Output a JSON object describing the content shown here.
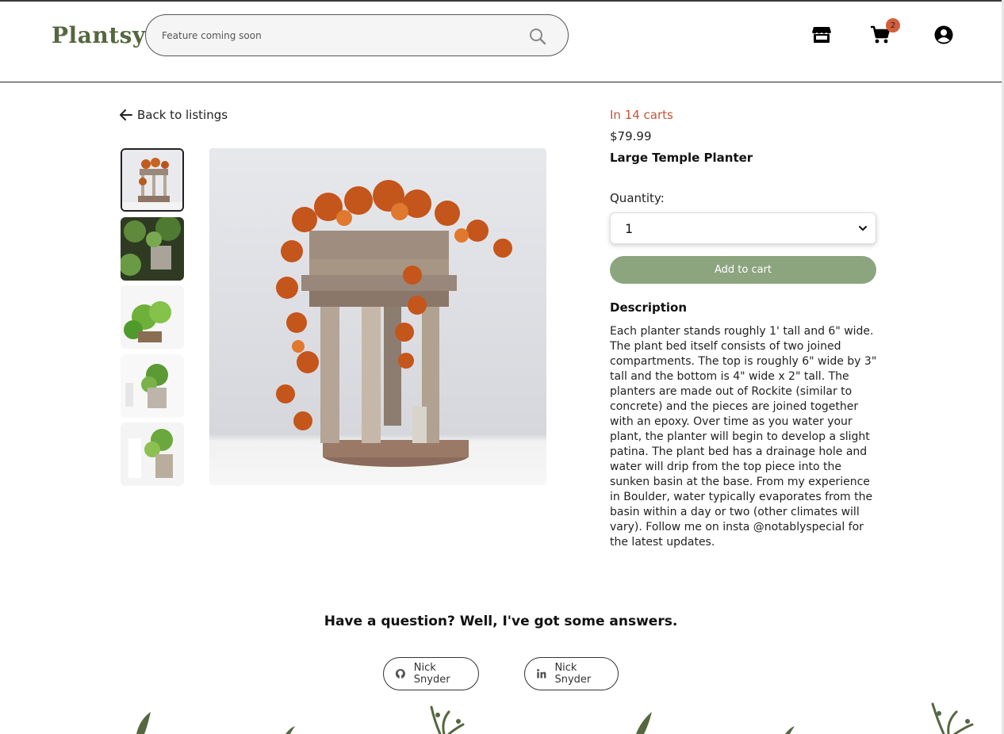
{
  "header": {
    "logo": "Plantsy",
    "search_placeholder": "Feature coming soon",
    "cart_count": "2",
    "icons": [
      "store-icon",
      "cart-icon",
      "account-icon",
      "search-icon"
    ]
  },
  "product": {
    "back_label": "Back to listings",
    "in_carts": "In 14 carts",
    "price": "$79.99",
    "title": "Large Temple Planter",
    "quantity_label": "Quantity:",
    "quantity_value": "1",
    "add_to_cart": "Add to cart",
    "description_heading": "Description",
    "description": "Each planter stands roughly 1' tall and 6\" wide. The plant bed itself consists of two joined compartments. The top is roughly 6\" wide by 3\" tall and the bottom is 4\" wide x 2\" tall. The planters are made out of Rockite (similar to concrete) and the pieces are joined together with an epoxy. Over time as you water your plant, the planter will begin to develop a slight patina. The plant bed has a drainage hole and water will drip from the top piece into the sunken basin at the base. From my experience in Boulder, water typically evaporates from the basin within a day or two (other climates will vary). Follow me on insta @notablyspecial for the latest updates."
  },
  "footer": {
    "question": "Have a question? Well, I've got some answers.",
    "github_label": "Nick Snyder",
    "linkedin_label": "Nick Snyder"
  },
  "colors": {
    "brand": "#55673f",
    "accent_button": "#8da57f",
    "carts_text": "#c0573a",
    "badge": "#d25f3a"
  }
}
